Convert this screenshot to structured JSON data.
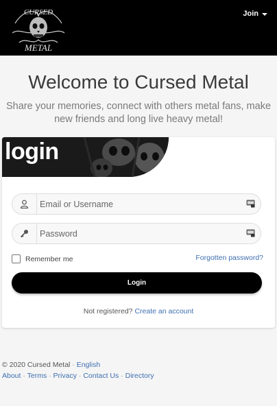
{
  "nav": {
    "logo_text": "CURSED METAL",
    "join_label": "Join"
  },
  "hero": {
    "title": "Welcome to Cursed Metal",
    "subtitle": "Share your memories, connect with others metal fans, make new friends and long live heavy metal!"
  },
  "login_card": {
    "heading": "login",
    "username_placeholder": "Email or Username",
    "username_value": "",
    "password_placeholder": "Password",
    "password_value": "",
    "remember_label": "Remember me",
    "remember_checked": false,
    "forgot_label": "Forgotten password?",
    "submit_label": "Login",
    "register_prompt": "Not registered?",
    "register_link": "Create an account"
  },
  "footer": {
    "copyright": "© 2020 Cursed Metal",
    "language": "English",
    "links": [
      "About",
      "Terms",
      "Privacy",
      "Contact Us",
      "Directory"
    ]
  },
  "icons": {
    "user": "user-icon",
    "key": "key-icon",
    "autofill": "password-manager-icon",
    "caret": "caret-down-icon"
  },
  "colors": {
    "navbar": "#000000",
    "link": "#3e6fb0",
    "button": "#000000",
    "page_bg": "#f5f5f5"
  }
}
